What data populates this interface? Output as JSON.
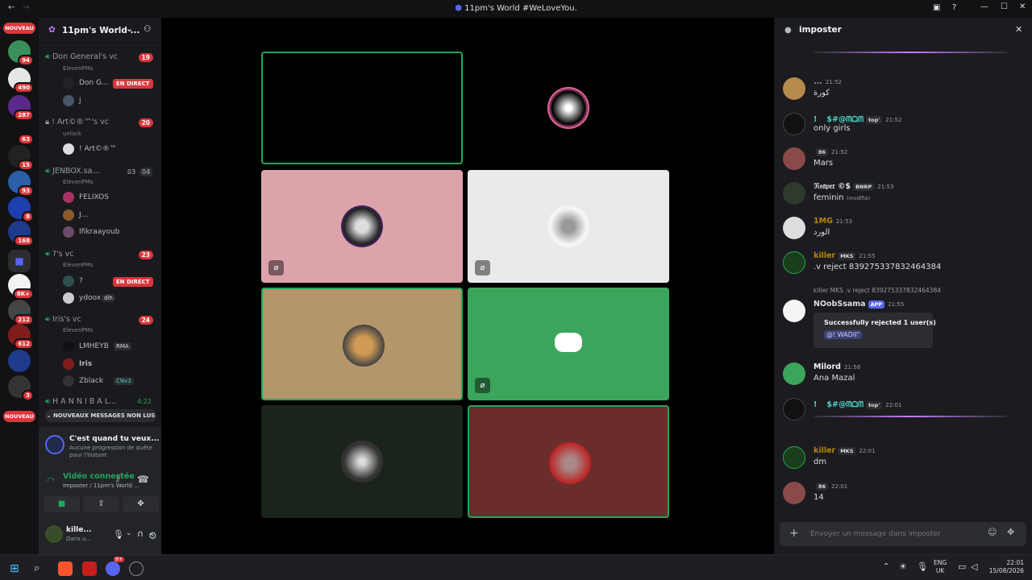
{
  "window": {
    "title": "11pm's World #WeLoveYou.",
    "back_icon": "back-arrow-icon",
    "forward_icon": "forward-arrow-icon"
  },
  "servers": {
    "new_label": "NOUVEAU",
    "badges": [
      "94",
      "490",
      "287",
      "63",
      "15",
      "93",
      "8",
      "168",
      "8K+",
      "212",
      "612",
      "3"
    ]
  },
  "guild": {
    "name": "11pm's World ...",
    "add_member_icon": "add-member-icon"
  },
  "channels": [
    {
      "name": "Don General's vc",
      "count": "19",
      "sub": "ElevenPMs",
      "users": [
        "Don G...",
        "j"
      ],
      "live": "EN DIRECT"
    },
    {
      "name": "! Art©®™'s vc",
      "count": "20",
      "sub": "unlock",
      "users": [
        "! Art©®™"
      ]
    },
    {
      "name": "JENBOX.sa...",
      "count_a": "03",
      "count_b": "04",
      "sub": "ElevenPMs",
      "users": [
        "FELIXOS",
        "J...",
        "Ifikraayoub"
      ]
    },
    {
      "name": "?'s vc",
      "count": "23",
      "sub": "ElevenPMs",
      "users": [
        "?",
        "ydoox"
      ],
      "live": "EN DIRECT",
      "tag": "dih"
    },
    {
      "name": "Iris's vc",
      "count": "24",
      "sub": "ElevenPMs",
      "users": [
        "LMHEYB",
        "Iris",
        "Zblack"
      ],
      "tags": [
        "RMA",
        "CNv3"
      ]
    },
    {
      "name": "H A N N I B A L...",
      "time": "4:22"
    }
  ],
  "unread_banner": "NOUVEAUX MESSAGES NON LUS",
  "quest": {
    "title": "C'est quand tu veux...",
    "desc": "Aucune progression de quête pour l'instant"
  },
  "voice": {
    "status": "Vidéo connectée",
    "location": "imposter / 11pm's World ..."
  },
  "user": {
    "name": "kille...",
    "status": "Dans u..."
  },
  "chat": {
    "channel": "imposter",
    "input_placeholder": "Envoyer un message dans imposter",
    "messages": [
      {
        "name": "...",
        "time": "21:52",
        "text": "كورة",
        "color": "#949ba4"
      },
      {
        "name": "! ﾠ$#@ᗰᗝᗰ",
        "time": "21:52",
        "text": "only girls",
        "color": "#4fd1c5",
        "tag": "top'"
      },
      {
        "name": "",
        "time": "21:52",
        "text": "Mars",
        "color": "#dbdee1",
        "tag": "86"
      },
      {
        "name": "ℜ𝔢𝔞𝔭𝔢𝔯 ©$",
        "time": "21:53",
        "text": "feminin",
        "edited": "(modifié)",
        "color": "#dbdee1",
        "tag": "BNRP"
      },
      {
        "name": "1MG",
        "time": "21:53",
        "text": "الورد",
        "color": "#b8860b"
      },
      {
        "name": "killer",
        "time": "21:55",
        "text": ".v reject 839275337832464384",
        "color": "#b8860b",
        "tag": "MKS"
      },
      {
        "name": "NOobSsama",
        "time": "21:55",
        "text": "",
        "color": "#dbdee1",
        "tag": "APP",
        "reply": "killer MKS .v reject 839275337832464384",
        "embed_title": "Successfully rejected 1 user(s)",
        "embed_value": "@! WADII\""
      },
      {
        "name": "Milord",
        "time": "21:58",
        "text": "Ana Mazal",
        "color": "#f2f3f5"
      },
      {
        "name": "! ﾠ$#@ᗰᗝᗰ",
        "time": "22:01",
        "text": "",
        "color": "#4fd1c5",
        "tag": "top'"
      },
      {
        "name": "killer",
        "time": "22:01",
        "text": "dm",
        "color": "#b8860b",
        "tag": "MKS"
      },
      {
        "name": "",
        "time": "22:01",
        "text": "14",
        "color": "#dbdee1",
        "tag": "86"
      }
    ]
  },
  "taskbar": {
    "lang": "ENG",
    "region": "UK",
    "time": "22:01",
    "date": "15/08/2026",
    "badge": "9+"
  },
  "colors": {
    "accent": "#5865f2",
    "green": "#23a55a",
    "red": "#da373c"
  }
}
